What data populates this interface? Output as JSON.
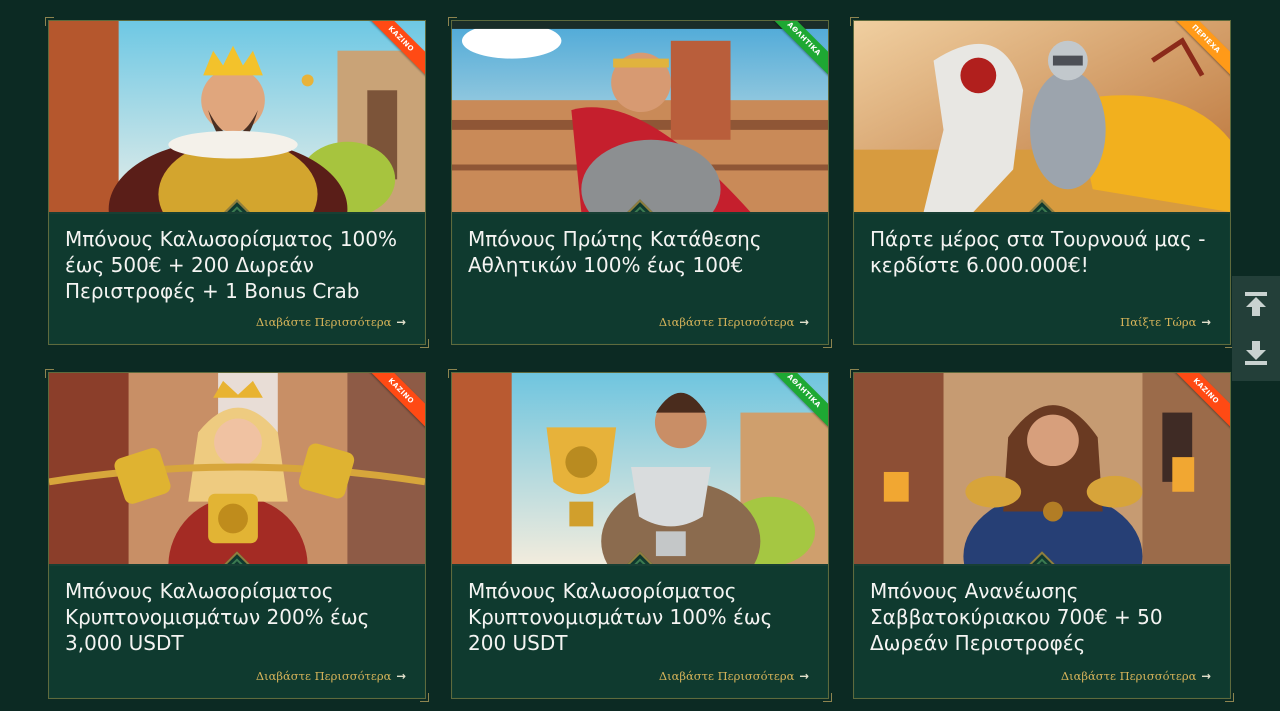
{
  "cards": [
    {
      "badge": "ΚΑΖΙΝΟ",
      "badge_color": "#ff4a14",
      "title_lines": [
        "Μπόνους Καλωσορίσματος 100%",
        "έως 500€ + 200 Δωρεάν",
        "Περιστροφές + 1 Bonus Crab"
      ],
      "link_label": "Διαβάστε Περισσότερα",
      "image_subject": "king"
    },
    {
      "badge": "ΑΘΛΗΤΙΚΑ",
      "badge_color": "#1ea833",
      "title_lines": [
        "Μπόνους Πρώτης Κατάθεσης",
        "Αθλητικών 100% έως 100€"
      ],
      "link_label": "Διαβάστε Περισσότερα",
      "image_subject": "gladiator"
    },
    {
      "badge": "ΠΕΡΙΕΧΑ",
      "badge_color": "#ff9a18",
      "title_lines": [
        "Πάρτε μέρος στα Τουρνουά μας -",
        "κερδίστε 6.000.000€!"
      ],
      "link_label": "Παίξτε Τώρα",
      "image_subject": "knight"
    },
    {
      "badge": "ΚΑΖΙΝΟ",
      "badge_color": "#ff4a14",
      "title_lines": [
        "Μπόνους Καλωσορίσματος",
        "Κρυπτονομισμάτων 200% έως",
        "3,000 USDT"
      ],
      "link_label": "Διαβάστε Περισσότερα",
      "image_subject": "crypto-queen"
    },
    {
      "badge": "ΑΘΛΗΤΙΚΑ",
      "badge_color": "#1ea833",
      "title_lines": [
        "Μπόνους Καλωσορίσματος",
        "Κρυπτονομισμάτων 100% έως",
        "200 USDT"
      ],
      "link_label": "Διαβάστε Περισσότερα",
      "image_subject": "trophy-warrior"
    },
    {
      "badge": "ΚΑΖΙΝΟ",
      "badge_color": "#ff4a14",
      "title_lines": [
        "Μπόνους Ανανέωσης",
        "Σαββατοκύριακου 700€ + 50",
        "Δωρεάν Περιστροφές"
      ],
      "link_label": "Διαβάστε Περισσότερα",
      "image_subject": "female-warrior"
    }
  ],
  "side_controls": [
    {
      "icon": "arrow-up-to-top-icon"
    },
    {
      "icon": "arrow-down-to-bottom-icon"
    }
  ]
}
